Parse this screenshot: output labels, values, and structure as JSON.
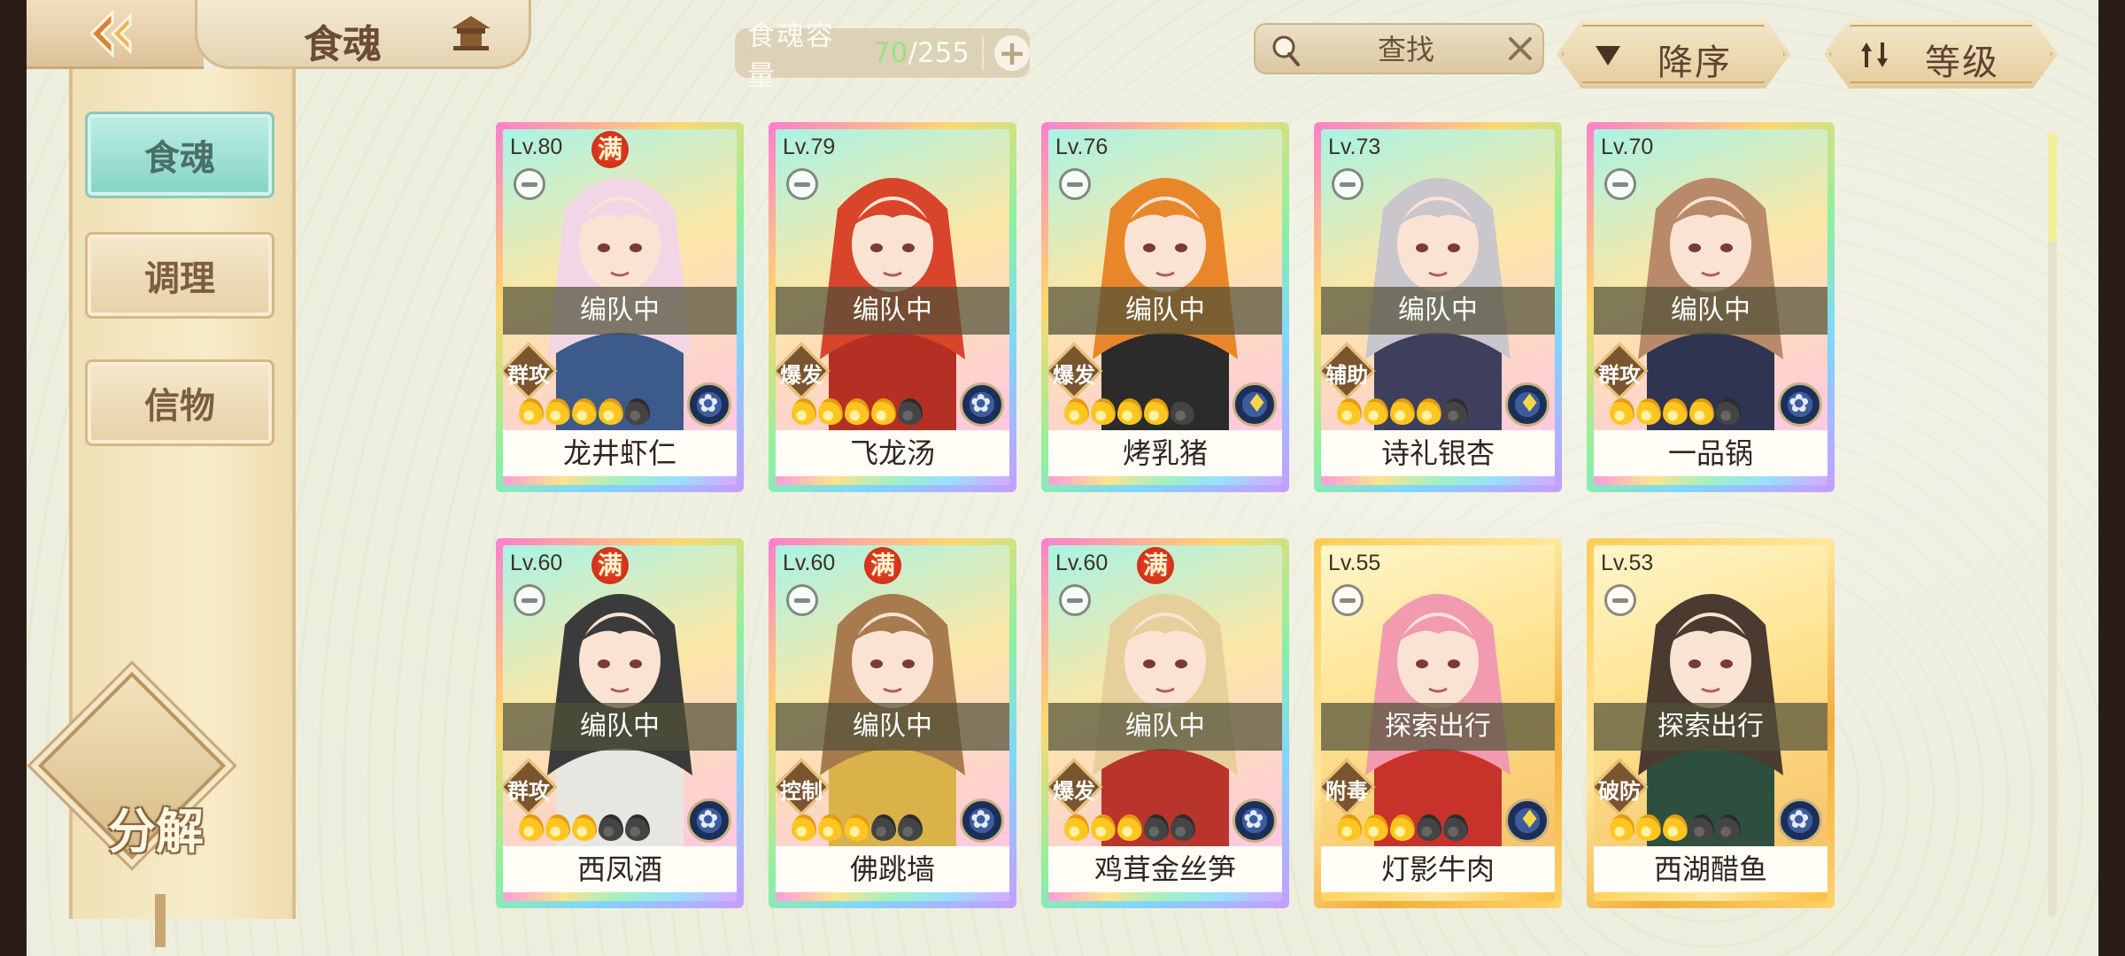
{
  "header": {
    "title": "食魂",
    "capacity": {
      "label": "食魂容量",
      "current": "70",
      "separator": "/",
      "max": "255"
    },
    "search": {
      "placeholder": "查找"
    },
    "sort_order_label": "降序",
    "sort_type_label": "等级"
  },
  "sidebar": {
    "tabs": [
      {
        "label": "食魂",
        "active": true
      },
      {
        "label": "调理",
        "active": false
      },
      {
        "label": "信物",
        "active": false
      }
    ],
    "decompose_label": "分解"
  },
  "max_badge_text": "满",
  "cards": [
    {
      "level": "Lv.80",
      "max": true,
      "status": "编队中",
      "role": "群攻",
      "stars_filled": 4,
      "stars_total": 5,
      "element": "blue",
      "name": "龙井虾仁",
      "frame": "rainbow"
    },
    {
      "level": "Lv.79",
      "max": false,
      "status": "编队中",
      "role": "爆发",
      "stars_filled": 4,
      "stars_total": 5,
      "element": "blue",
      "name": "飞龙汤",
      "frame": "rainbow"
    },
    {
      "level": "Lv.76",
      "max": false,
      "status": "编队中",
      "role": "爆发",
      "stars_filled": 4,
      "stars_total": 5,
      "element": "gold",
      "name": "烤乳猪",
      "frame": "rainbow"
    },
    {
      "level": "Lv.73",
      "max": false,
      "status": "编队中",
      "role": "辅助",
      "stars_filled": 4,
      "stars_total": 5,
      "element": "gold",
      "name": "诗礼银杏",
      "frame": "rainbow"
    },
    {
      "level": "Lv.70",
      "max": false,
      "status": "编队中",
      "role": "群攻",
      "stars_filled": 4,
      "stars_total": 5,
      "element": "blue",
      "name": "一品锅",
      "frame": "rainbow"
    },
    {
      "level": "Lv.60",
      "max": true,
      "status": "编队中",
      "role": "群攻",
      "stars_filled": 3,
      "stars_total": 5,
      "element": "blue",
      "name": "西凤酒",
      "frame": "rainbow"
    },
    {
      "level": "Lv.60",
      "max": true,
      "status": "编队中",
      "role": "控制",
      "stars_filled": 3,
      "stars_total": 5,
      "element": "blue",
      "name": "佛跳墙",
      "frame": "rainbow"
    },
    {
      "level": "Lv.60",
      "max": true,
      "status": "编队中",
      "role": "爆发",
      "stars_filled": 3,
      "stars_total": 5,
      "element": "blue",
      "name": "鸡茸金丝笋",
      "frame": "rainbow"
    },
    {
      "level": "Lv.55",
      "max": false,
      "status": "探索出行",
      "role": "附毒",
      "stars_filled": 3,
      "stars_total": 5,
      "element": "gold",
      "name": "灯影牛肉",
      "frame": "gold"
    },
    {
      "level": "Lv.53",
      "max": false,
      "status": "探索出行",
      "role": "破防",
      "stars_filled": 3,
      "stars_total": 5,
      "element": "blue",
      "name": "西湖醋鱼",
      "frame": "gold"
    }
  ],
  "colors": {
    "background": "#edeedd",
    "active_tab": "#83d4c4",
    "capacity_current": "#9be07f",
    "max_badge": "#e84a2b"
  }
}
